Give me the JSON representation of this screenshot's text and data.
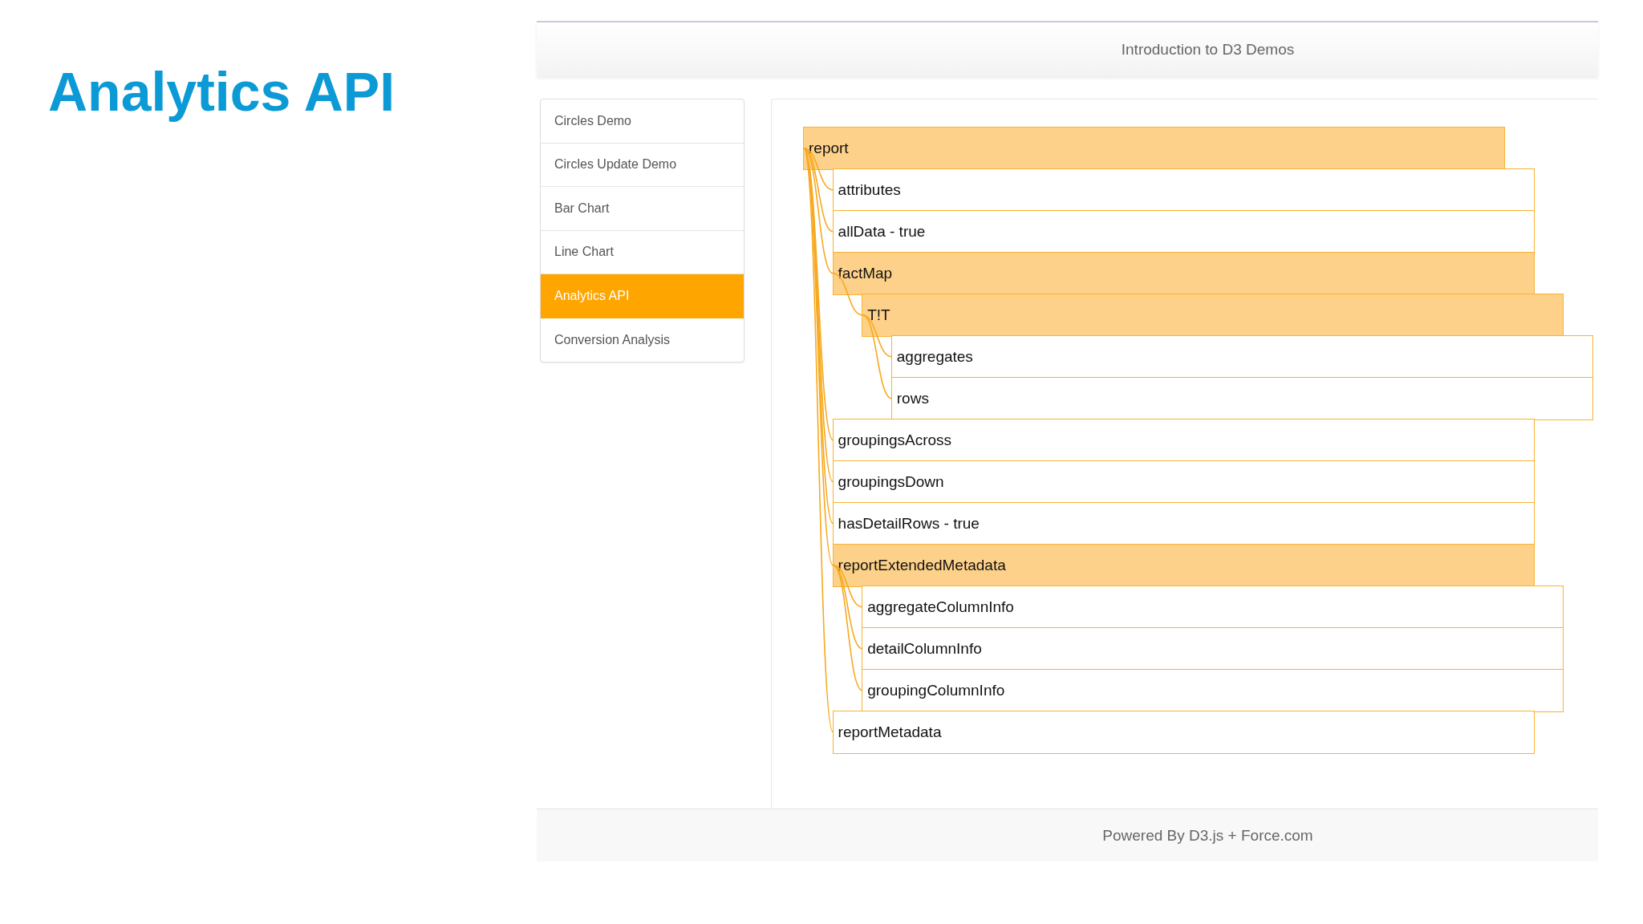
{
  "slide": {
    "title": "Analytics API"
  },
  "app": {
    "header": {
      "title": "Introduction to D3 Demos"
    },
    "sidebar": {
      "items": [
        {
          "label": "Circles Demo",
          "selected": false
        },
        {
          "label": "Circles Update Demo",
          "selected": false
        },
        {
          "label": "Bar Chart",
          "selected": false
        },
        {
          "label": "Line Chart",
          "selected": false
        },
        {
          "label": "Analytics API",
          "selected": true
        },
        {
          "label": "Conversion Analysis",
          "selected": false
        }
      ]
    },
    "tree": {
      "nodes": [
        {
          "label": "report",
          "expanded": true,
          "children": [
            {
              "label": "attributes",
              "expanded": false
            },
            {
              "label": "allData - true",
              "expanded": false
            },
            {
              "label": "factMap",
              "expanded": true,
              "children": [
                {
                  "label": "T!T",
                  "expanded": true,
                  "children": [
                    {
                      "label": "aggregates",
                      "expanded": false
                    },
                    {
                      "label": "rows",
                      "expanded": false
                    }
                  ]
                }
              ]
            },
            {
              "label": "groupingsAcross",
              "expanded": false
            },
            {
              "label": "groupingsDown",
              "expanded": false
            },
            {
              "label": "hasDetailRows - true",
              "expanded": false
            },
            {
              "label": "reportExtendedMetadata",
              "expanded": true,
              "children": [
                {
                  "label": "aggregateColumnInfo",
                  "expanded": false
                },
                {
                  "label": "detailColumnInfo",
                  "expanded": false
                },
                {
                  "label": "groupingColumnInfo",
                  "expanded": false
                }
              ]
            },
            {
              "label": "reportMetadata",
              "expanded": false
            }
          ]
        }
      ]
    },
    "footer": {
      "text": "Powered By D3.js + Force.com"
    }
  }
}
